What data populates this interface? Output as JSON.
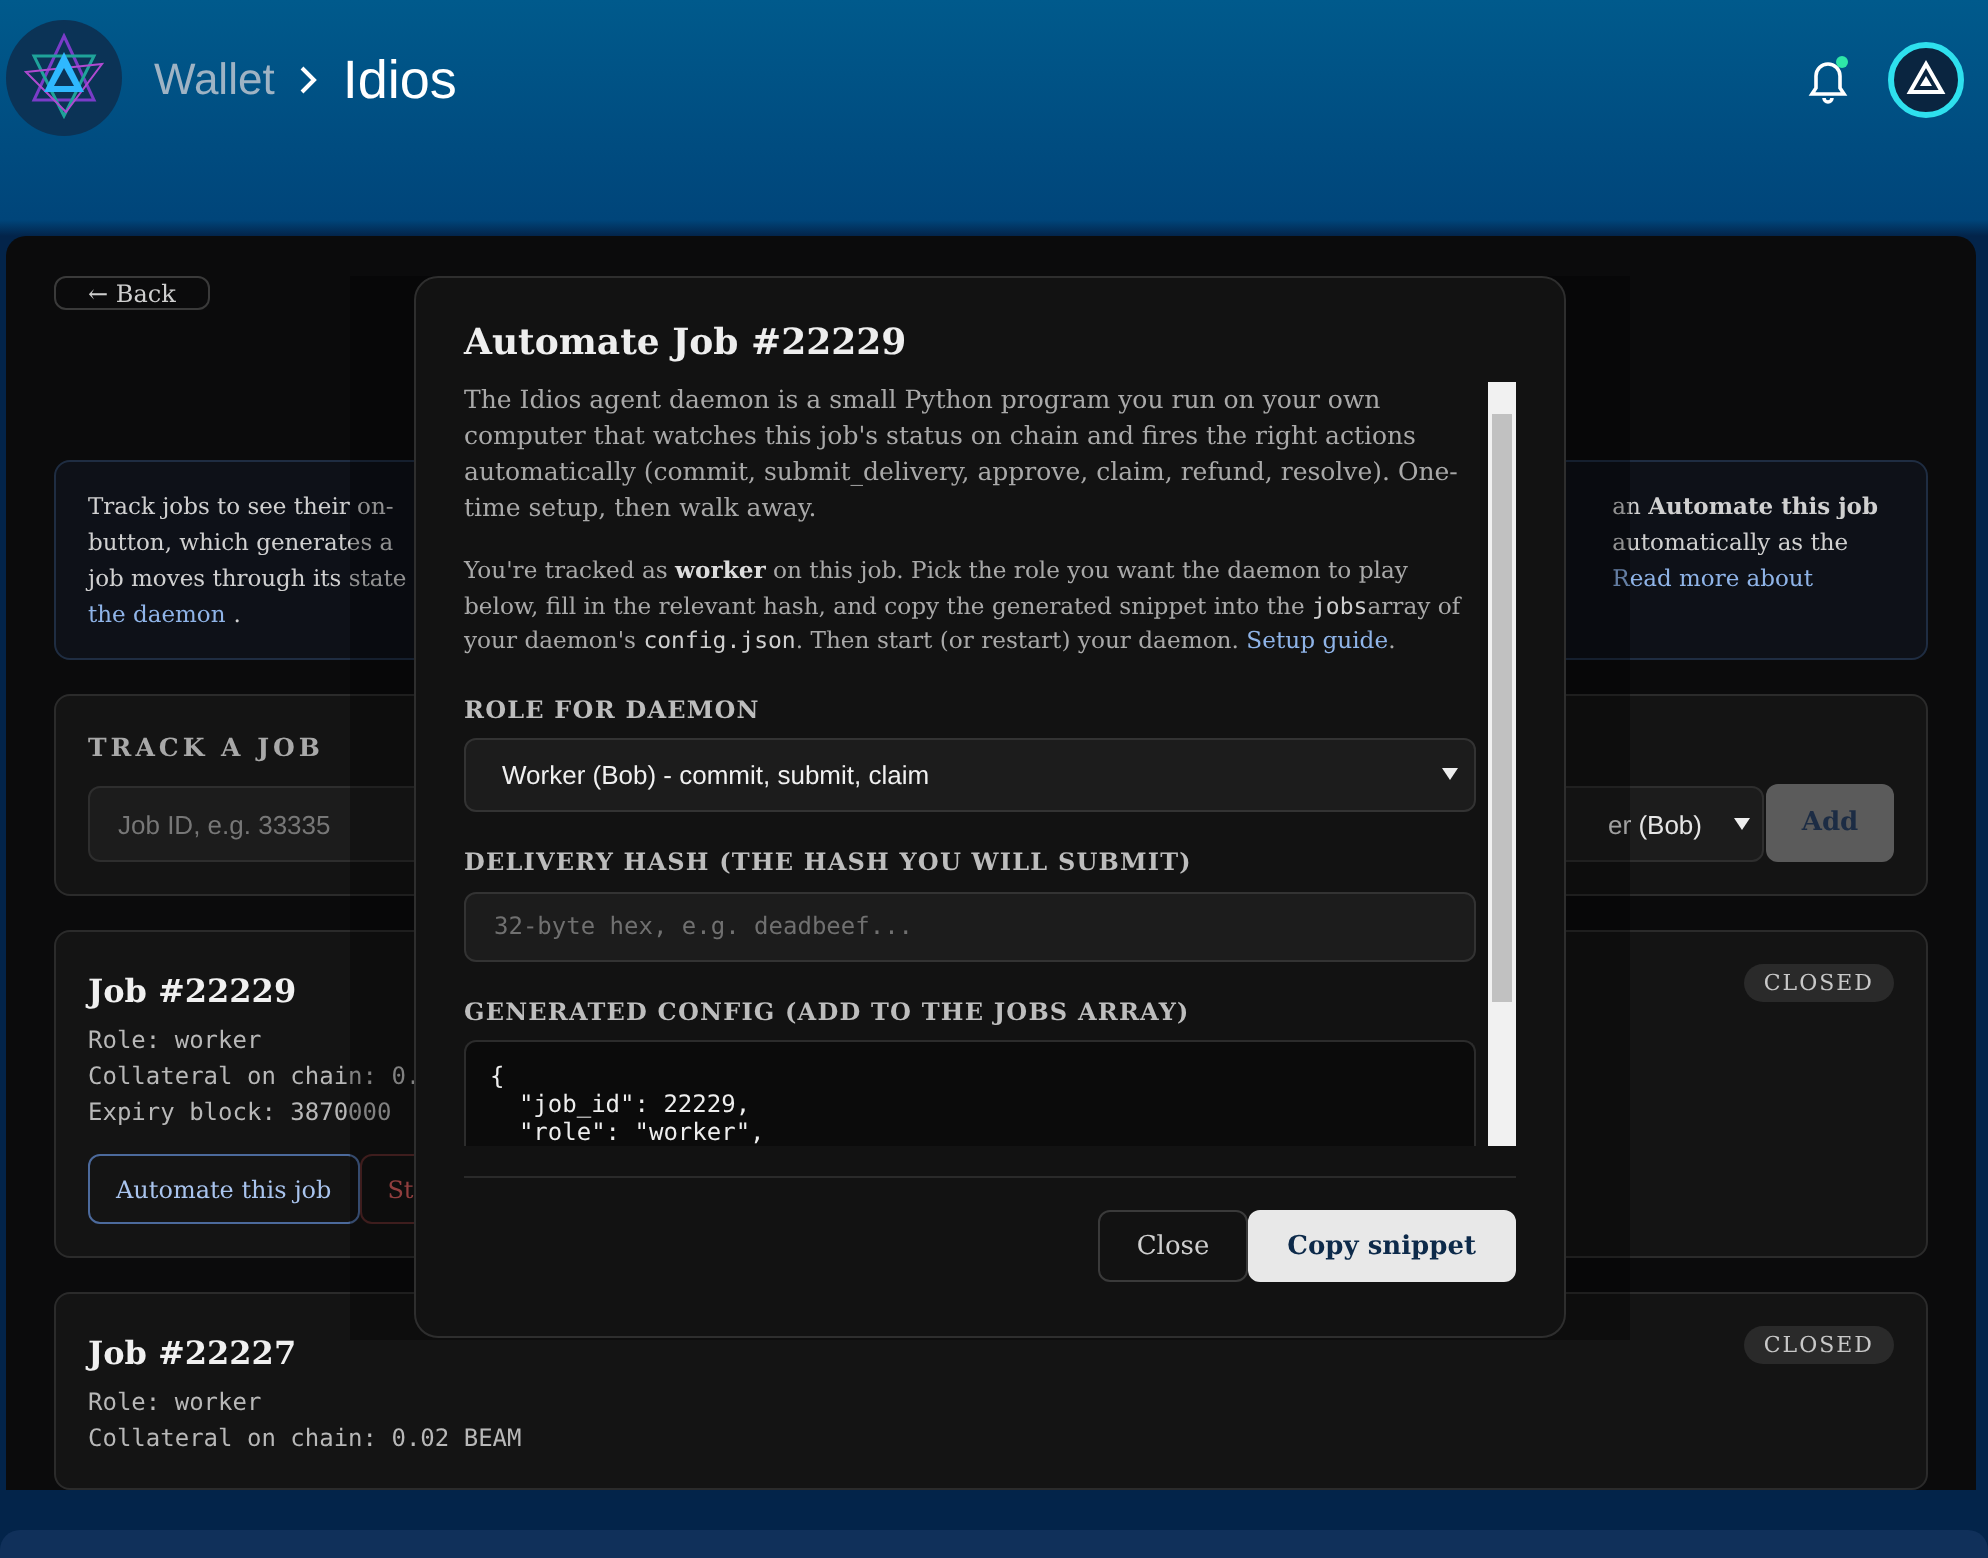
{
  "header": {
    "breadcrumb": [
      "Wallet",
      "Idios"
    ],
    "unread": true
  },
  "back_button": "← Back",
  "info": {
    "left_lines": [
      [
        {
          "kind": "text",
          "text": "Track jobs to see their on-"
        }
      ],
      [
        {
          "kind": "text",
          "text": "button, which generates a"
        }
      ],
      [
        {
          "kind": "text",
          "text": "job moves through its state"
        }
      ],
      [
        {
          "kind": "link",
          "text": "the daemon"
        },
        {
          "kind": "text",
          "text": "."
        }
      ]
    ],
    "right_lines": [
      [
        {
          "kind": "text",
          "text": "an **Automate this job**"
        }
      ],
      [
        {
          "kind": "text",
          "text": "automatically as the"
        }
      ],
      [
        {
          "kind": "link",
          "text": "Read more about"
        }
      ]
    ]
  },
  "track": {
    "title": "TRACK A JOB",
    "placeholder": "Job ID, e.g. 33335",
    "role_value": "er (Bob)",
    "button": "Add"
  },
  "jobs": [
    {
      "title": "Job #22229",
      "status": "CLOSED",
      "lines": [
        "Role: worker",
        "Collateral on chain: 0.",
        "Expiry block: 3870000"
      ],
      "actions": [
        {
          "kind": "primary",
          "label": "Automate this job"
        },
        {
          "kind": "danger",
          "label": "St"
        }
      ]
    },
    {
      "title": "Job #22227",
      "status": "CLOSED",
      "lines": [
        "Role: worker",
        "Collateral on chain: 0.02 BEAM"
      ]
    }
  ],
  "modal": {
    "title": "Automate Job #22229",
    "intro": "The Idios agent daemon is a small Python program you run on your own computer that watches this job's status on chain and fires the right actions automatically (commit, submit_delivery, approve, claim, refund, resolve). One-time setup, then walk away.",
    "instructions": [
      {
        "kind": "text",
        "text": "You're tracked as **worker** on this job. Pick the role you want the daemon to play below, fill in the relevant hash, and copy the generated snippet into the "
      },
      {
        "kind": "code",
        "text": "jobs"
      },
      {
        "kind": "text",
        "text": "array of your daemon's "
      },
      {
        "kind": "code",
        "text": "config.json"
      },
      {
        "kind": "text",
        "text": ". Then start (or restart) your daemon. "
      },
      {
        "kind": "link",
        "text": "Setup guide"
      },
      {
        "kind": "text",
        "text": "."
      }
    ],
    "role_label": "ROLE FOR DAEMON",
    "role_value": "Worker (Bob) - commit, submit, claim",
    "hash_label": "DELIVERY HASH (THE HASH YOU WILL SUBMIT)",
    "hash_placeholder": "32-byte hex, e.g. deadbeef...",
    "config_label": "GENERATED CONFIG (ADD TO THE JOBS ARRAY)",
    "config_lines": [
      "{",
      "  \"job_id\": 22229,",
      "  \"role\": \"worker\","
    ],
    "buttons": [
      {
        "kind": "secondary",
        "label": "Close"
      },
      {
        "kind": "primary",
        "label": "Copy snippet"
      }
    ]
  }
}
